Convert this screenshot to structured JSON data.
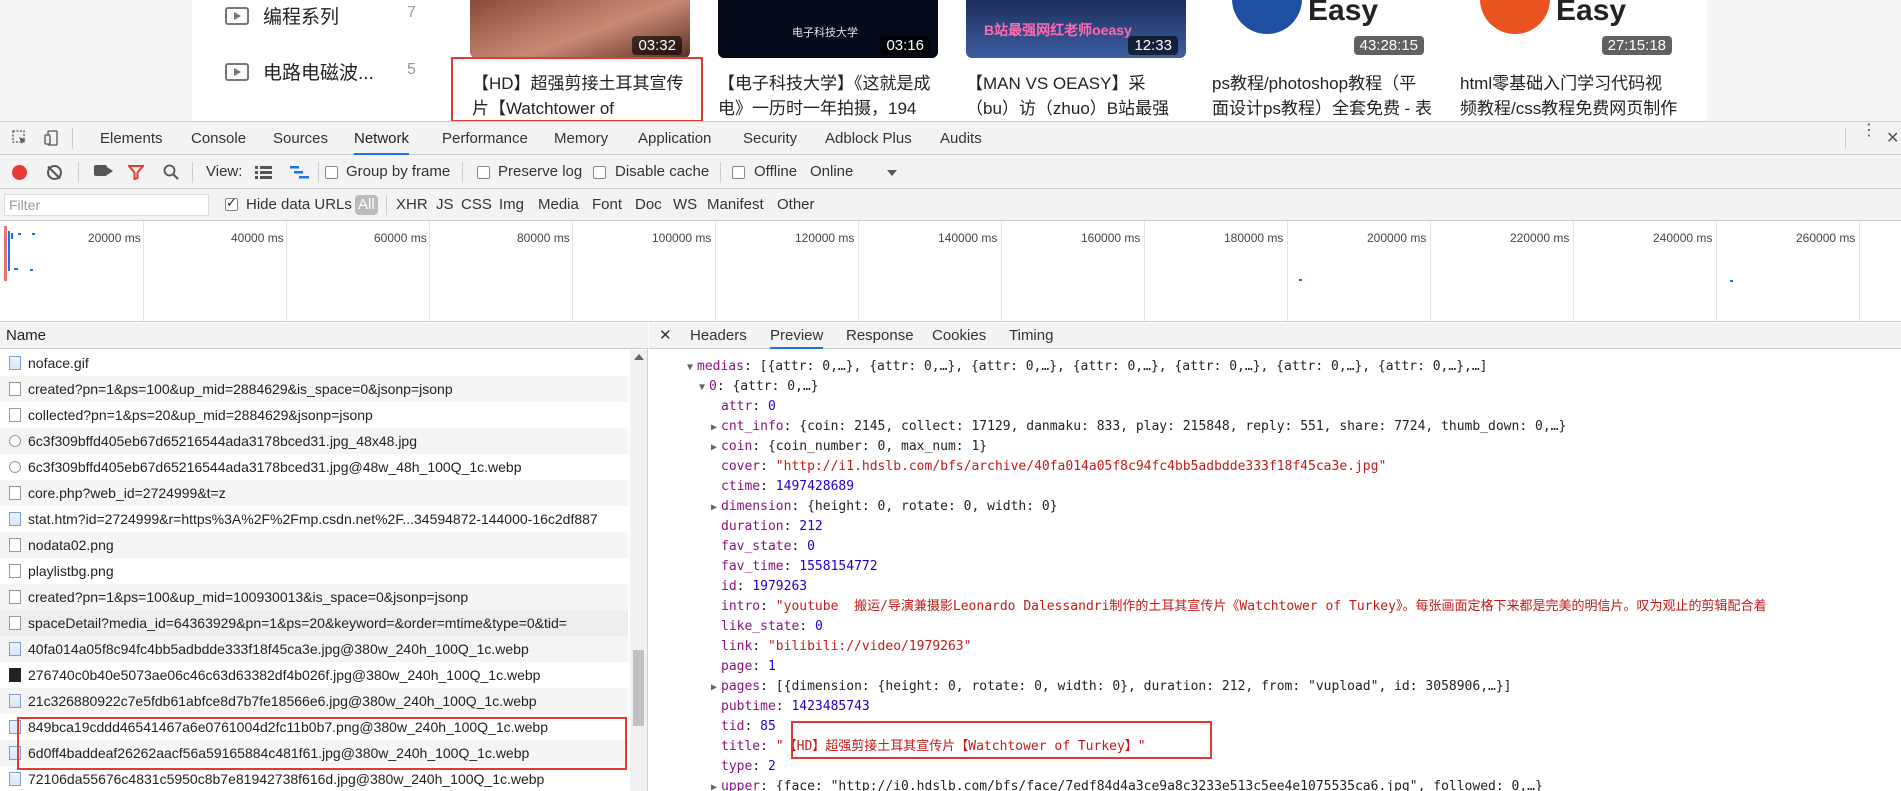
{
  "webpage": {
    "sidebar": [
      {
        "label": "编程系列",
        "count": "7"
      },
      {
        "label": "电路电磁波...",
        "count": "5"
      }
    ],
    "videos": [
      {
        "duration": "03:32",
        "title_line1": "【HD】超强剪接土耳其宣传",
        "title_line2": "片【Watchtower of",
        "thumb": "#6b3a30",
        "thumb_text": ""
      },
      {
        "duration": "03:16",
        "title_line1": "【电子科技大学】《这就是成",
        "title_line2": "电》一历时一年拍摄，194",
        "thumb": "#050a1a",
        "thumb_text": "电子科技大学"
      },
      {
        "duration": "12:33",
        "title_line1": "【MAN VS OEASY】采",
        "title_line2": "（bu）访（zhuo）B站最强",
        "thumb": "#2a3d6b",
        "thumb_text": "B站最强网红老师oeasy"
      },
      {
        "duration": "43:28:15",
        "title_line1": "ps教程/photoshop教程（平",
        "title_line2": "面设计ps教程）全套免费 - 表",
        "thumb": "#ffffff",
        "thumb_text": "Easy"
      },
      {
        "duration": "27:15:18",
        "title_line1": "html零基础入门学习代码视",
        "title_line2": "频教程/css教程免费网页制作",
        "thumb": "#ffffff",
        "thumb_text": "Easy"
      }
    ]
  },
  "devtools": {
    "tabs": [
      "Elements",
      "Console",
      "Sources",
      "Network",
      "Performance",
      "Memory",
      "Application",
      "Security",
      "Adblock Plus",
      "Audits"
    ],
    "active_tab": "Network",
    "toolbar": {
      "view_label": "View:",
      "group_by_frame": "Group by frame",
      "preserve_log": "Preserve log",
      "disable_cache": "Disable cache",
      "offline": "Offline",
      "throttle": "Online"
    },
    "filter": {
      "placeholder": "Filter",
      "hide_data_urls": "Hide data URLs",
      "types": [
        "All",
        "XHR",
        "JS",
        "CSS",
        "Img",
        "Media",
        "Font",
        "Doc",
        "WS",
        "Manifest",
        "Other"
      ]
    },
    "timeline_ticks": [
      "20000 ms",
      "40000 ms",
      "60000 ms",
      "80000 ms",
      "100000 ms",
      "120000 ms",
      "140000 ms",
      "160000 ms",
      "180000 ms",
      "200000 ms",
      "220000 ms",
      "240000 ms",
      "260000 ms"
    ],
    "name_header": "Name",
    "requests": [
      {
        "name": "noface.gif",
        "icon": "img"
      },
      {
        "name": "created?pn=1&ps=100&up_mid=2884629&is_space=0&jsonp=jsonp",
        "icon": "doc"
      },
      {
        "name": "collected?pn=1&ps=20&up_mid=2884629&jsonp=jsonp",
        "icon": "doc"
      },
      {
        "name": "6c3f309bffd405eb67d65216544ada3178bced31.jpg_48x48.jpg",
        "icon": "circ"
      },
      {
        "name": "6c3f309bffd405eb67d65216544ada3178bced31.jpg@48w_48h_100Q_1c.webp",
        "icon": "circ"
      },
      {
        "name": "core.php?web_id=2724999&t=z",
        "icon": "doc"
      },
      {
        "name": "stat.htm?id=2724999&r=https%3A%2F%2Fmp.csdn.net%2F...34594872-144000-16c2df887",
        "icon": "img"
      },
      {
        "name": "nodata02.png",
        "icon": "doc"
      },
      {
        "name": "playlistbg.png",
        "icon": "doc"
      },
      {
        "name": "created?pn=1&ps=100&up_mid=100930013&is_space=0&jsonp=jsonp",
        "icon": "doc"
      },
      {
        "name": "spaceDetail?media_id=64363929&pn=1&ps=20&keyword=&order=mtime&type=0&tid=",
        "icon": "doc"
      },
      {
        "name": "40fa014a05f8c94fc4bb5adbdde333f18f45ca3e.jpg@380w_240h_100Q_1c.webp",
        "icon": "img"
      },
      {
        "name": "276740c0b40e5073ae06c46c63d63382df4b026f.jpg@380w_240h_100Q_1c.webp",
        "icon": "dark"
      },
      {
        "name": "21c326880922c7e5fdb61abfce8d7b7fe18566e6.jpg@380w_240h_100Q_1c.webp",
        "icon": "img"
      },
      {
        "name": "849bca19cddd46541467a6e0761004d2fc11b0b7.png@380w_240h_100Q_1c.webp",
        "icon": "img"
      },
      {
        "name": "6d0ff4baddeaf26262aacf56a59165884c481f61.jpg@380w_240h_100Q_1c.webp",
        "icon": "img"
      },
      {
        "name": "72106da55676c4831c5950c8b7e81942738f616d.jpg@380w_240h_100Q_1c.webp",
        "icon": "img"
      }
    ],
    "preview_tabs": [
      "Headers",
      "Preview",
      "Response",
      "Cookies",
      "Timing"
    ],
    "active_preview_tab": "Preview",
    "json_lines": [
      {
        "indent": 0,
        "tri": "▼",
        "key": "medias",
        "rest": "[{attr: 0,…}, {attr: 0,…}, {attr: 0,…}, {attr: 0,…}, {attr: 0,…}, {attr: 0,…}, {attr: 0,…},…]",
        "cls": ""
      },
      {
        "indent": 1,
        "tri": "▼",
        "key": "0",
        "rest": "{attr: 0,…}",
        "cls": ""
      },
      {
        "indent": 2,
        "tri": "",
        "key": "attr",
        "rest": "0",
        "cls": "n"
      },
      {
        "indent": 2,
        "tri": "▶",
        "key": "cnt_info",
        "rest": "{coin: 2145, collect: 17129, danmaku: 833, play: 215848, reply: 551, share: 7724, thumb_down: 0,…}",
        "cls": ""
      },
      {
        "indent": 2,
        "tri": "▶",
        "key": "coin",
        "rest": "{coin_number: 0, max_num: 1}",
        "cls": ""
      },
      {
        "indent": 2,
        "tri": "",
        "key": "cover",
        "rest": "\"http://i1.hdslb.com/bfs/archive/40fa014a05f8c94fc4bb5adbdde333f18f45ca3e.jpg\"",
        "cls": "s"
      },
      {
        "indent": 2,
        "tri": "",
        "key": "ctime",
        "rest": "1497428689",
        "cls": "n"
      },
      {
        "indent": 2,
        "tri": "▶",
        "key": "dimension",
        "rest": "{height: 0, rotate: 0, width: 0}",
        "cls": ""
      },
      {
        "indent": 2,
        "tri": "",
        "key": "duration",
        "rest": "212",
        "cls": "n"
      },
      {
        "indent": 2,
        "tri": "",
        "key": "fav_state",
        "rest": "0",
        "cls": "n"
      },
      {
        "indent": 2,
        "tri": "",
        "key": "fav_time",
        "rest": "1558154772",
        "cls": "n"
      },
      {
        "indent": 2,
        "tri": "",
        "key": "id",
        "rest": "1979263",
        "cls": "n"
      },
      {
        "indent": 2,
        "tri": "",
        "key": "intro",
        "rest": "\"youtube  搬运/导演兼摄影Leonardo Dalessandri制作的土耳其宣传片《Watchtower of Turkey》。每张画面定格下来都是完美的明信片。叹为观止的剪辑配合着",
        "cls": "s"
      },
      {
        "indent": 2,
        "tri": "",
        "key": "like_state",
        "rest": "0",
        "cls": "n"
      },
      {
        "indent": 2,
        "tri": "",
        "key": "link",
        "rest": "\"bilibili://video/1979263\"",
        "cls": "s"
      },
      {
        "indent": 2,
        "tri": "",
        "key": "page",
        "rest": "1",
        "cls": "n"
      },
      {
        "indent": 2,
        "tri": "▶",
        "key": "pages",
        "rest": "[{dimension: {height: 0, rotate: 0, width: 0}, duration: 212, from: \"vupload\", id: 3058906,…}]",
        "cls": ""
      },
      {
        "indent": 2,
        "tri": "",
        "key": "pubtime",
        "rest": "1423485743",
        "cls": "n"
      },
      {
        "indent": 2,
        "tri": "",
        "key": "tid",
        "rest": "85",
        "cls": "n"
      },
      {
        "indent": 2,
        "tri": "",
        "key": "title",
        "rest": "\"【HD】超强剪接土耳其宣传片【Watchtower of Turkey】\"",
        "cls": "s"
      },
      {
        "indent": 2,
        "tri": "",
        "key": "type",
        "rest": "2",
        "cls": "n"
      },
      {
        "indent": 2,
        "tri": "▶",
        "key": "upper",
        "rest": "{face: \"http://i0.hdslb.com/bfs/face/7edf84d4a3ce9a8c3233e513c5ee4e1075535ca6.jpg\", followed: 0,…}",
        "cls": ""
      }
    ]
  }
}
